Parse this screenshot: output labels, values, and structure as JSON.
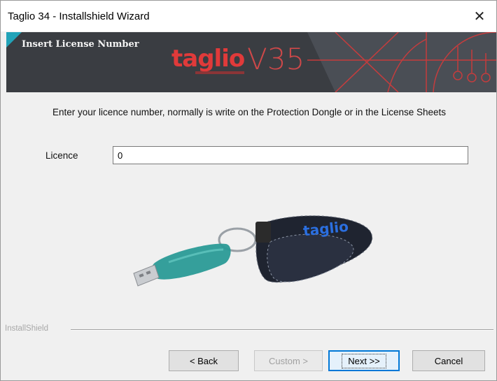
{
  "window": {
    "title": "Taglio 34 - Installshield Wizard",
    "close_glyph": "✕"
  },
  "banner": {
    "title": "Insert License Number",
    "logo": "taglio",
    "version": "V35",
    "accent_color": "#e03a3a",
    "corner_color": "#22a3b8"
  },
  "main": {
    "instruction": "Enter your licence number, normally is write on the Protection Dongle or in the License Sheets",
    "licence_label": "Licence",
    "licence_value": "0",
    "dongle_brand": "taglio"
  },
  "footer": {
    "brand": "InstallShield",
    "buttons": {
      "back": "< Back",
      "custom": "Custom >",
      "next": "Next >>",
      "cancel": "Cancel"
    }
  }
}
